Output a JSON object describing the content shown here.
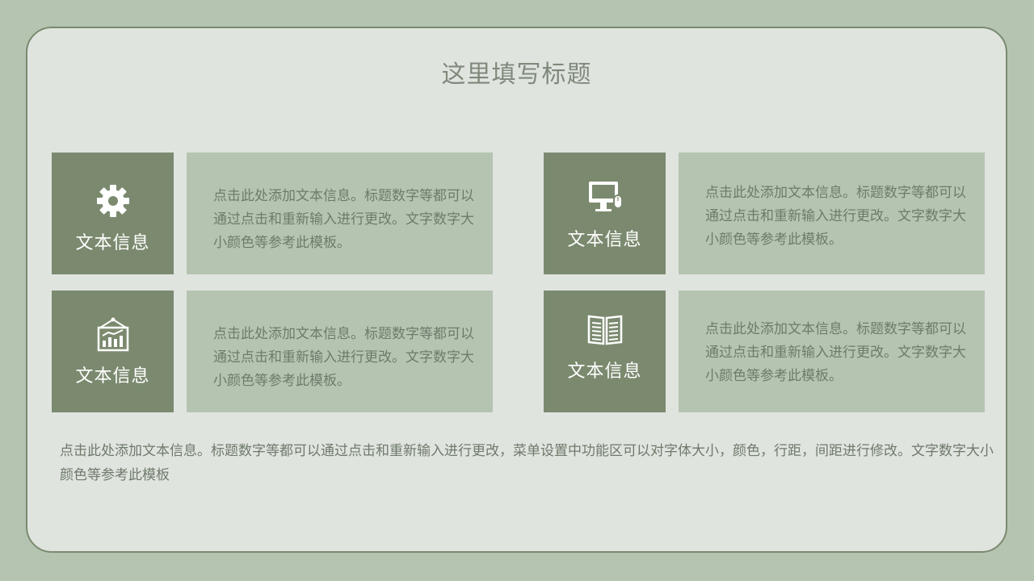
{
  "slide": {
    "title": "这里填写标题",
    "blocks": [
      {
        "label": "文本信息",
        "icon": "gear-icon",
        "text": "点击此处添加文本信息。标题数字等都可以通过点击和重新输入进行更改。文字数字大小颜色等参考此模板。"
      },
      {
        "label": "文本信息",
        "icon": "computer-icon",
        "text": "点击此处添加文本信息。标题数字等都可以通过点击和重新输入进行更改。文字数字大小颜色等参考此模板。"
      },
      {
        "label": "文本信息",
        "icon": "chart-board-icon",
        "text": "点击此处添加文本信息。标题数字等都可以通过点击和重新输入进行更改。文字数字大小颜色等参考此模板。"
      },
      {
        "label": "文本信息",
        "icon": "book-icon",
        "text": "点击此处添加文本信息。标题数字等都可以通过点击和重新输入进行更改。文字数字大小颜色等参考此模板。"
      }
    ],
    "footer": "点击此处添加文本信息。标题数字等都可以通过点击和重新输入进行更改，菜单设置中功能区可以对字体大小，颜色，行距，间距进行修改。文字数字大小颜色等参考此模板"
  },
  "colors": {
    "background": "#b5c4b1",
    "card": "#e0e4df",
    "tile": "#7b8a6f",
    "text": "#6e7a6b"
  }
}
